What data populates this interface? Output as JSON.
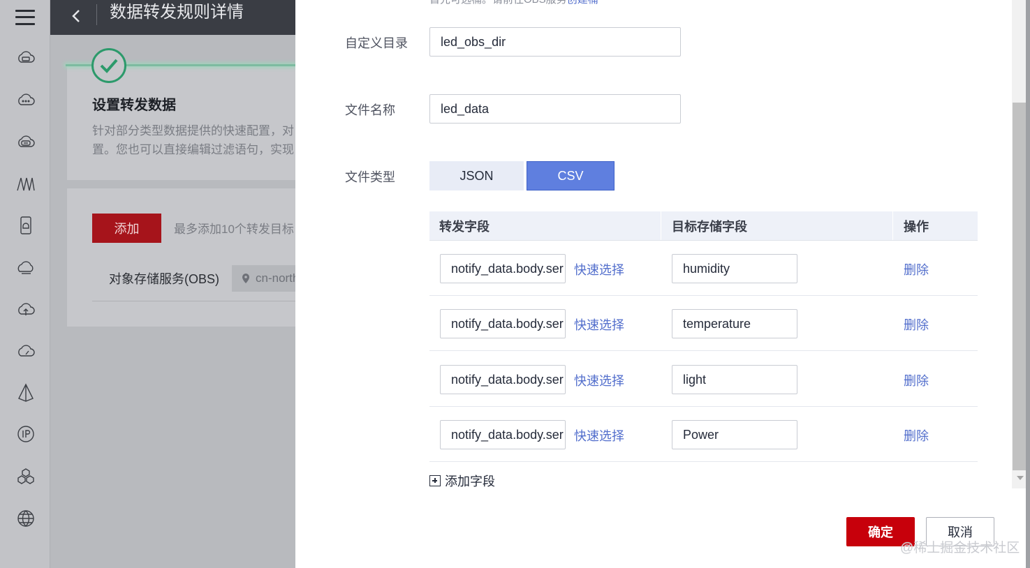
{
  "header": {
    "title": "数据转发规则详情"
  },
  "background": {
    "step_title": "设置转发数据",
    "step_desc_line1": "针对部分类型数据提供的快速配置，对",
    "step_desc_line2": "置。您也可以直接编辑过滤语句，实现",
    "add_button": "添加",
    "add_hint": "最多添加10个转发目标",
    "obs_label": "对象存储服务(OBS)",
    "region": "cn-north"
  },
  "drawer": {
    "top_hint": "首先可选桶。请前往OBS服务",
    "top_hint_link": "创建桶",
    "custom_dir_label": "自定义目录",
    "custom_dir_value": "led_obs_dir",
    "file_name_label": "文件名称",
    "file_name_value": "led_data",
    "file_type_label": "文件类型",
    "file_type_options": [
      "JSON",
      "CSV"
    ],
    "file_type_selected": "CSV",
    "table": {
      "headers": [
        "转发字段",
        "目标存储字段",
        "操作"
      ],
      "rows": [
        {
          "source": "notify_data.body.services",
          "quick": "快速选择",
          "target": "humidity",
          "action": "删除"
        },
        {
          "source": "notify_data.body.services",
          "quick": "快速选择",
          "target": "temperature",
          "action": "删除"
        },
        {
          "source": "notify_data.body.services",
          "quick": "快速选择",
          "target": "light",
          "action": "删除"
        },
        {
          "source": "notify_data.body.services",
          "quick": "快速选择",
          "target": "Power",
          "action": "删除"
        }
      ]
    },
    "add_field": "添加字段",
    "ok_button": "确定",
    "cancel_button": "取消",
    "watermark": "@稀土掘金技术社区"
  },
  "colors": {
    "primary": "#c7000b",
    "link": "#526ecc",
    "selected_segment": "#5f7fdf"
  }
}
